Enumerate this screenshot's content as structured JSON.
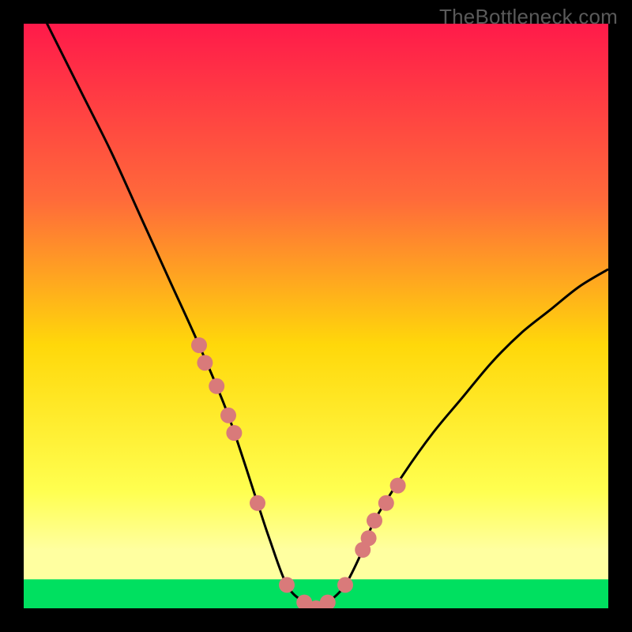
{
  "watermark": "TheBottleneck.com",
  "colors": {
    "gradient_top": "#ff1a4a",
    "gradient_mid1": "#ff6a3a",
    "gradient_mid2": "#ffd80a",
    "gradient_mid3": "#ffff50",
    "gradient_bottom_band": "#ffffa0",
    "gradient_green": "#00e060",
    "curve": "#000000",
    "marker_fill": "#d97a7a",
    "marker_stroke": "#c46060"
  },
  "chart_data": {
    "type": "line",
    "title": "",
    "xlabel": "",
    "ylabel": "",
    "xlim": [
      0,
      100
    ],
    "ylim": [
      0,
      100
    ],
    "grid": false,
    "legend": false,
    "series": [
      {
        "name": "bottleneck-curve",
        "x": [
          0,
          5,
          10,
          15,
          20,
          25,
          30,
          35,
          40,
          42,
          45,
          48,
          50,
          52,
          55,
          58,
          60,
          65,
          70,
          75,
          80,
          85,
          90,
          95,
          100
        ],
        "values": [
          108,
          98,
          88,
          78,
          67,
          56,
          45,
          33,
          18,
          12,
          4,
          1,
          0,
          1,
          4,
          10,
          15,
          23,
          30,
          36,
          42,
          47,
          51,
          55,
          58
        ]
      }
    ],
    "markers": {
      "name": "highlighted-points",
      "x": [
        30,
        31,
        33,
        35,
        36,
        40,
        45,
        48,
        50,
        52,
        55,
        58,
        59,
        60,
        62,
        64
      ],
      "values": [
        45,
        42,
        38,
        33,
        30,
        18,
        4,
        1,
        0,
        1,
        4,
        10,
        12,
        15,
        18,
        21
      ]
    }
  }
}
